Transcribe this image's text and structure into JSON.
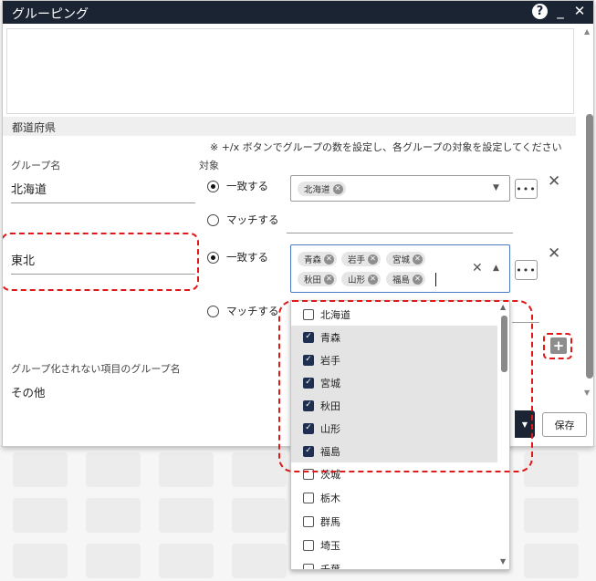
{
  "window": {
    "title": "グルーピング"
  },
  "section": {
    "title": "都道府県"
  },
  "note": "※ +/x ボタンでグループの数を設定し、各グループの対象を設定してください",
  "columns": {
    "group_name": "グループ名",
    "target": "対象"
  },
  "groups": [
    {
      "name": "北海道",
      "match_label": "一致する",
      "pattern_label": "マッチする",
      "chips": [
        "北海道"
      ]
    },
    {
      "name": "東北",
      "match_label": "一致する",
      "pattern_label": "マッチする",
      "chips": [
        "青森",
        "岩手",
        "宮城",
        "秋田",
        "山形",
        "福島"
      ]
    }
  ],
  "ungrouped": {
    "label": "グループ化されない項目のグループ名",
    "value": "その他"
  },
  "buttons": {
    "save": "保存",
    "more": "•••"
  },
  "dropdown": {
    "items": [
      {
        "label": "北海道",
        "checked": false
      },
      {
        "label": "青森",
        "checked": true
      },
      {
        "label": "岩手",
        "checked": true
      },
      {
        "label": "宮城",
        "checked": true
      },
      {
        "label": "秋田",
        "checked": true
      },
      {
        "label": "山形",
        "checked": true
      },
      {
        "label": "福島",
        "checked": true
      },
      {
        "label": "茨城",
        "checked": false
      },
      {
        "label": "栃木",
        "checked": false
      },
      {
        "label": "群馬",
        "checked": false
      },
      {
        "label": "埼玉",
        "checked": false
      },
      {
        "label": "千葉",
        "checked": false
      }
    ]
  },
  "icons": {
    "help": "help-icon",
    "minimize": "minimize-icon",
    "close": "close-icon",
    "chip_remove": "chip-remove-icon",
    "caret": "chevron-down-icon",
    "add": "plus-icon"
  },
  "colors": {
    "titlebar": "#1b2433",
    "highlight": "#e01818",
    "checkbox": "#1f2f52"
  }
}
